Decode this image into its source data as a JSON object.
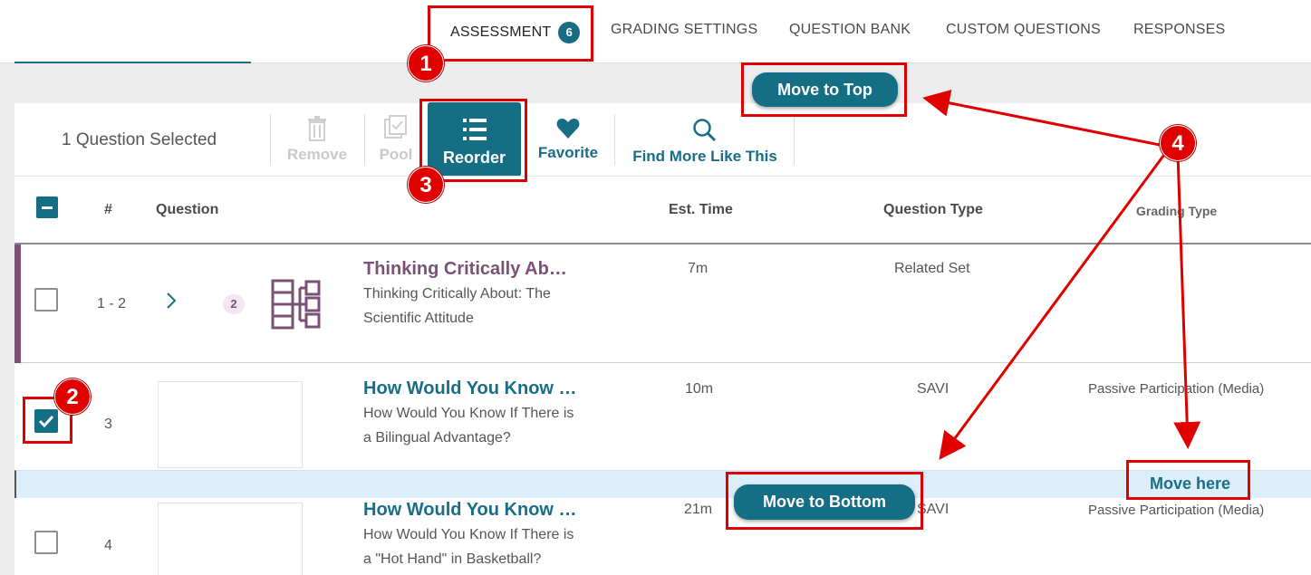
{
  "nav": {
    "tabs": [
      {
        "label": "ASSESSMENT",
        "badge": "6"
      },
      {
        "label": "GRADING SETTINGS"
      },
      {
        "label": "QUESTION BANK"
      },
      {
        "label": "CUSTOM QUESTIONS"
      },
      {
        "label": "RESPONSES"
      }
    ]
  },
  "toolbar": {
    "selected_text": "1 Question Selected",
    "remove_label": "Remove",
    "pool_label": "Pool",
    "reorder_label": "Reorder",
    "favorite_label": "Favorite",
    "find_more_label": "Find More Like This"
  },
  "move_to_top_label": "Move to Top",
  "move_to_bottom_label": "Move to Bottom",
  "move_here_label": "Move here",
  "table": {
    "headers": {
      "num": "#",
      "question": "Question",
      "est_time": "Est. Time",
      "question_type": "Question Type",
      "grading_type": "Grading Type"
    },
    "rows": [
      {
        "num": "1 - 2",
        "count": "2",
        "title": "Thinking Critically Ab…",
        "desc": "Thinking Critically About: The Scientific Attitude",
        "time": "7m",
        "qtype": "Related Set",
        "gtype": ""
      },
      {
        "num": "3",
        "title": "How Would You Know …",
        "desc": "How Would You Know If There is a Bilingual Advantage?",
        "time": "10m",
        "qtype": "SAVI",
        "gtype": "Passive Participation (Media)"
      },
      {
        "num": "4",
        "title": "How Would You Know …",
        "desc": "How Would You Know If There is a \"Hot Hand\" in Basketball?",
        "time": "21m",
        "qtype": "SAVI",
        "gtype": "Passive Participation (Media)"
      }
    ]
  },
  "annotations": {
    "m1": "1",
    "m2": "2",
    "m3": "3",
    "m4": "4"
  },
  "colors": {
    "accent": "#156f84",
    "related_set": "#7b5276",
    "annotation": "#e00000"
  }
}
